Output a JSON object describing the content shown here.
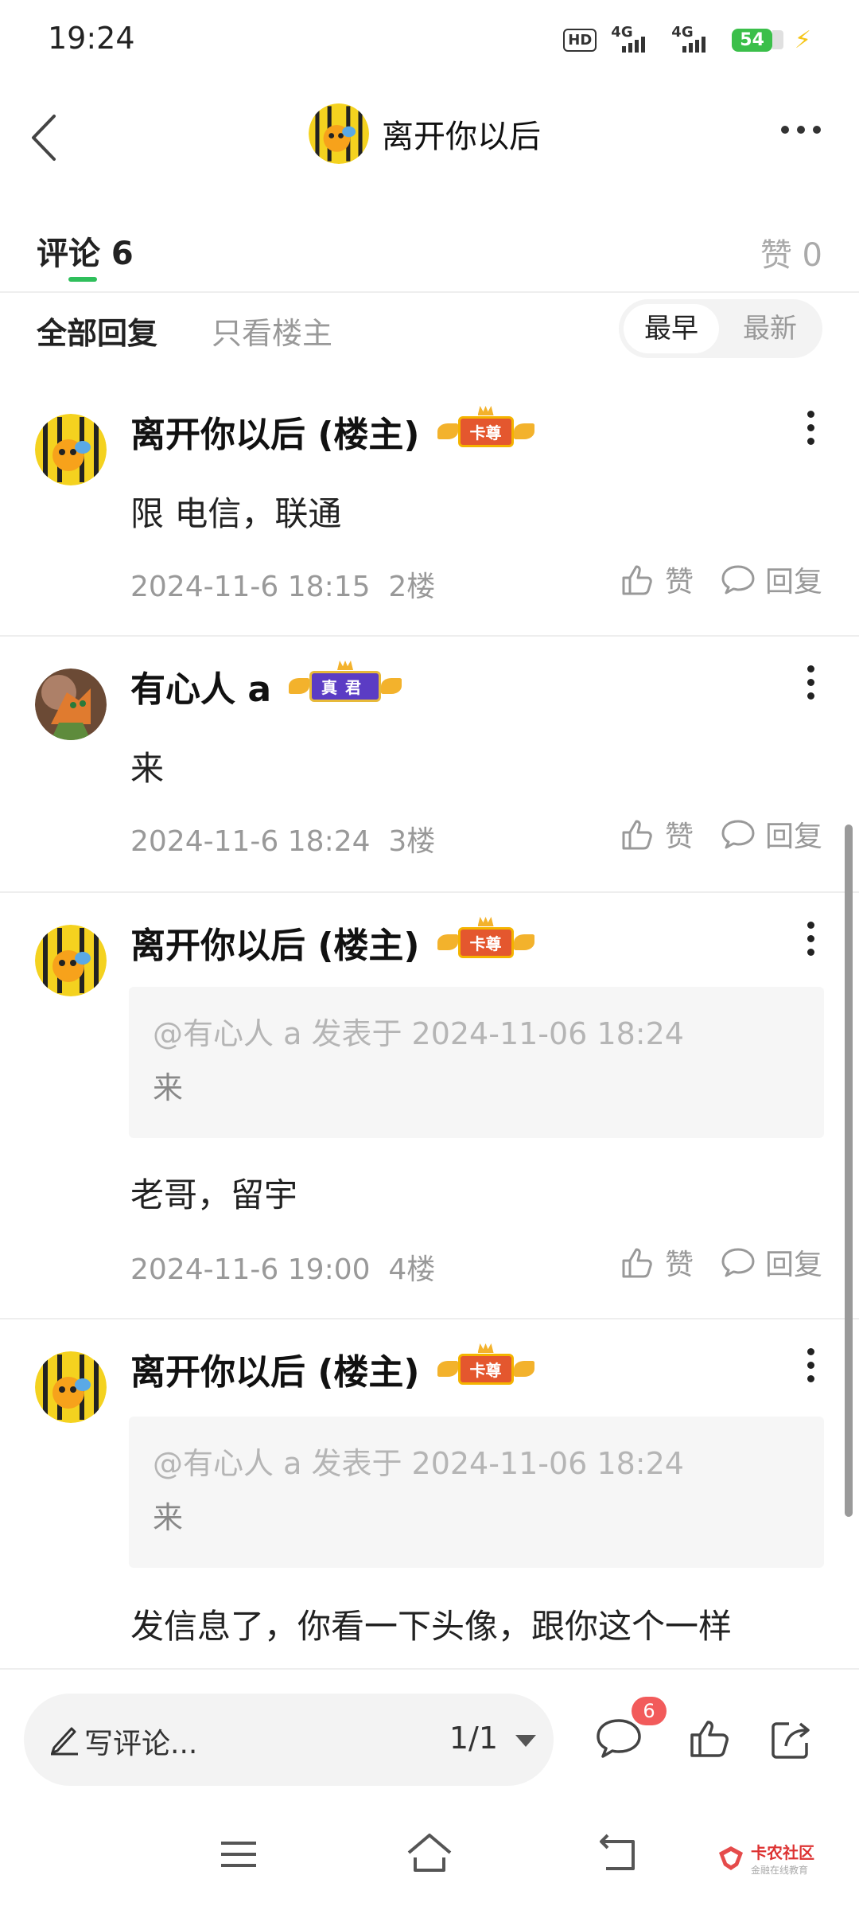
{
  "status_bar": {
    "time": "19:24",
    "hd": "HD",
    "sim1_label": "4G",
    "sim2_label": "4G",
    "battery": "54"
  },
  "header": {
    "title": "离开你以后"
  },
  "tabs": {
    "comments_label": "评论 6",
    "likes_label": "赞 0"
  },
  "filters": {
    "all": "全部回复",
    "owner_only": "只看楼主",
    "sort_earliest": "最早",
    "sort_latest": "最新"
  },
  "comments": [
    {
      "name": "离开你以后 (楼主)",
      "badge": "卡尊",
      "body": "限 电信，联通",
      "time": "2024-11-6 18:15",
      "floor": "2楼",
      "like_label": "赞",
      "reply_label": "回复"
    },
    {
      "name": "有心人 a",
      "badge": "真君",
      "body": "来",
      "time": "2024-11-6 18:24",
      "floor": "3楼",
      "like_label": "赞",
      "reply_label": "回复"
    },
    {
      "name": "离开你以后 (楼主)",
      "badge": "卡尊",
      "quote_header": "@有心人 a 发表于 2024-11-06 18:24",
      "quote_text": "来",
      "body": "老哥，留宇",
      "time": "2024-11-6 19:00",
      "floor": "4楼",
      "like_label": "赞",
      "reply_label": "回复"
    },
    {
      "name": "离开你以后 (楼主)",
      "badge": "卡尊",
      "quote_header": "@有心人 a 发表于 2024-11-06 18:24",
      "quote_text": "来",
      "body": "发信息了，你看一下头像，跟你这个一样"
    }
  ],
  "bottom_bar": {
    "compose_placeholder": "写评论...",
    "page_indicator": "1/1",
    "comment_count": "6"
  },
  "watermark": {
    "title": "卡农社区",
    "subtitle": "金融在线教育"
  },
  "colors": {
    "accent_green": "#2fbf5b",
    "badge_red": "#f25b5b",
    "muted_text": "#999999"
  }
}
